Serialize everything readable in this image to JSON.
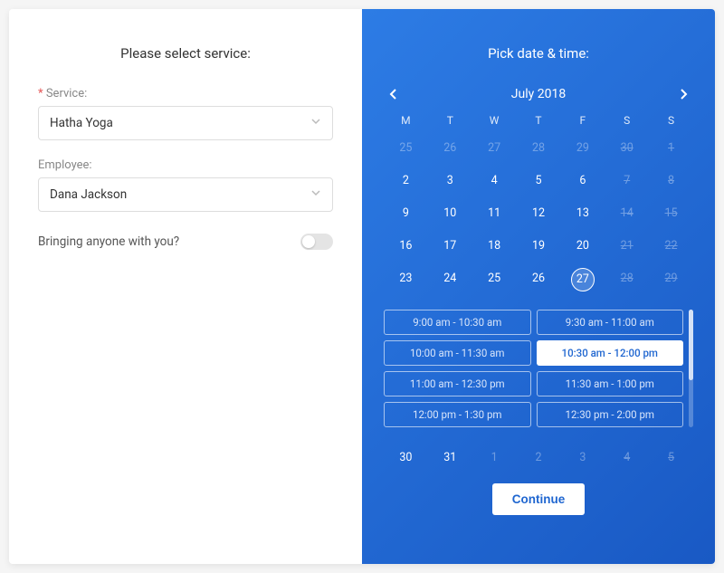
{
  "left": {
    "title": "Please select service:",
    "service_label": "Service:",
    "service_value": "Hatha Yoga",
    "employee_label": "Employee:",
    "employee_value": "Dana Jackson",
    "bringing_label": "Bringing anyone with you?",
    "bringing_on": false
  },
  "right": {
    "title": "Pick date & time:",
    "month_label": "July 2018",
    "dow": [
      "M",
      "T",
      "W",
      "T",
      "F",
      "S",
      "S"
    ],
    "weeks": [
      [
        {
          "n": 25,
          "state": "out"
        },
        {
          "n": 26,
          "state": "out"
        },
        {
          "n": 27,
          "state": "out"
        },
        {
          "n": 28,
          "state": "out"
        },
        {
          "n": 29,
          "state": "out"
        },
        {
          "n": 30,
          "state": "out dis"
        },
        {
          "n": 1,
          "state": "dis"
        }
      ],
      [
        {
          "n": 2,
          "state": ""
        },
        {
          "n": 3,
          "state": ""
        },
        {
          "n": 4,
          "state": ""
        },
        {
          "n": 5,
          "state": ""
        },
        {
          "n": 6,
          "state": ""
        },
        {
          "n": 7,
          "state": "dis"
        },
        {
          "n": 8,
          "state": "dis"
        }
      ],
      [
        {
          "n": 9,
          "state": ""
        },
        {
          "n": 10,
          "state": ""
        },
        {
          "n": 11,
          "state": ""
        },
        {
          "n": 12,
          "state": ""
        },
        {
          "n": 13,
          "state": ""
        },
        {
          "n": 14,
          "state": "dis"
        },
        {
          "n": 15,
          "state": "dis"
        }
      ],
      [
        {
          "n": 16,
          "state": ""
        },
        {
          "n": 17,
          "state": ""
        },
        {
          "n": 18,
          "state": ""
        },
        {
          "n": 19,
          "state": ""
        },
        {
          "n": 20,
          "state": ""
        },
        {
          "n": 21,
          "state": "dis"
        },
        {
          "n": 22,
          "state": "dis"
        }
      ],
      [
        {
          "n": 23,
          "state": ""
        },
        {
          "n": 24,
          "state": ""
        },
        {
          "n": 25,
          "state": ""
        },
        {
          "n": 26,
          "state": ""
        },
        {
          "n": 27,
          "state": "sel"
        },
        {
          "n": 28,
          "state": "dis"
        },
        {
          "n": 29,
          "state": "dis"
        }
      ],
      [
        {
          "n": 30,
          "state": ""
        },
        {
          "n": 31,
          "state": ""
        },
        {
          "n": 1,
          "state": "out"
        },
        {
          "n": 2,
          "state": "out"
        },
        {
          "n": 3,
          "state": "out"
        },
        {
          "n": 4,
          "state": "out dis"
        },
        {
          "n": 5,
          "state": "out dis"
        }
      ]
    ],
    "slots": [
      {
        "label": "9:00 am - 10:30 am",
        "sel": false
      },
      {
        "label": "9:30 am - 11:00 am",
        "sel": false
      },
      {
        "label": "10:00 am - 11:30 am",
        "sel": false
      },
      {
        "label": "10:30 am - 12:00 pm",
        "sel": true
      },
      {
        "label": "11:00 am - 12:30 pm",
        "sel": false
      },
      {
        "label": "11:30 am - 1:00 pm",
        "sel": false
      },
      {
        "label": "12:00 pm - 1:30 pm",
        "sel": false
      },
      {
        "label": "12:30 pm - 2:00 pm",
        "sel": false
      }
    ],
    "continue_label": "Continue"
  }
}
